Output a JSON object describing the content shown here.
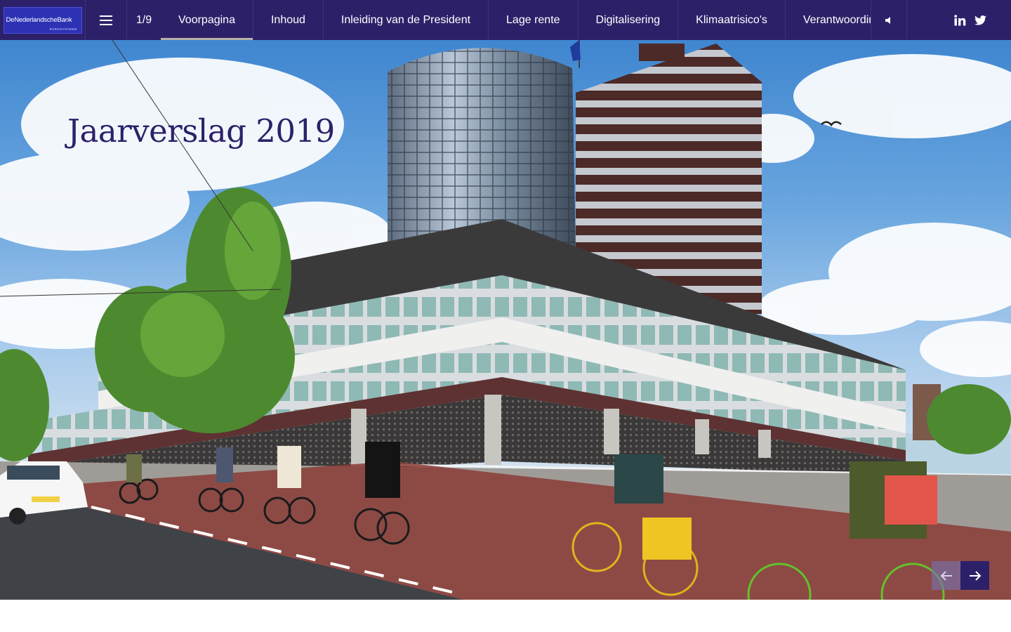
{
  "brand": {
    "logo_text": "DeNederlandscheBank",
    "logo_subtext": "EUROSYSTEEM",
    "color_primary": "#2c2169",
    "color_logo": "#2d32b4"
  },
  "header": {
    "menu_icon": "hamburger-menu-icon",
    "page_indicator": "1/9",
    "tabs": [
      {
        "label": "Voorpagina",
        "active": true
      },
      {
        "label": "Inhoud"
      },
      {
        "label": "Inleiding van de President"
      },
      {
        "label": "Lage rente"
      },
      {
        "label": "Digitalisering"
      },
      {
        "label": "Klimaatrisico's"
      },
      {
        "label": "Verantwoordir"
      }
    ],
    "sound_icon": "speaker-icon",
    "social": [
      {
        "name": "linkedin-icon"
      },
      {
        "name": "twitter-icon"
      }
    ]
  },
  "hero": {
    "title": "Jaarverslag 2019",
    "prev_icon": "arrow-left-icon",
    "next_icon": "arrow-right-icon"
  }
}
